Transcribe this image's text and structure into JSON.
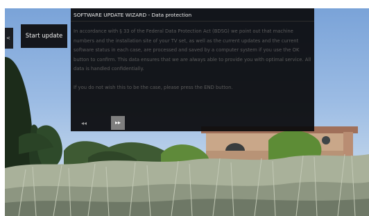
{
  "sidebar": {
    "tab_glyph": "<"
  },
  "start_button": {
    "label": "Start update"
  },
  "wizard": {
    "title": "SOFTWARE UPDATE WIZARD - Data protection",
    "paragraph_1": "In accordance with § 33 of the Federal Data Protection Act (BDSG) we point out that machine numbers and the installation site of your TV set, as well as the current updates and the current software status in each case, are processed and saved by a computer system if you use the OK button to confirm. This data ensures that we are always able to provide you with optimal service. All data is handled confidentially.",
    "paragraph_2": "If you do not wish this to be the case, please press the END button.",
    "back_label": "◂◂",
    "forward_label": "▸▸"
  },
  "colors": {
    "panel_background": "#0a0a0c",
    "title_text": "#ededed",
    "body_text": "#5c5c5c",
    "forward_button": "#7f7f7f"
  }
}
